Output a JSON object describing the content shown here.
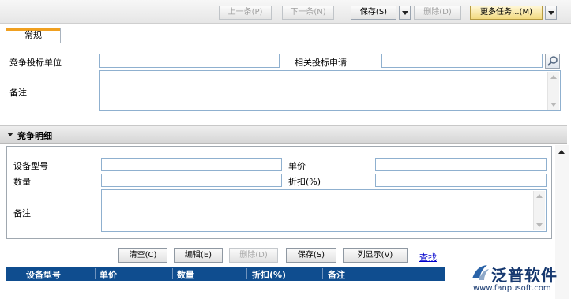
{
  "toolbar": {
    "prev": "上一条(P)",
    "next": "下一条(N)",
    "save": "保存(S)",
    "delete": "删除(D)",
    "more": "更多任务...(M)"
  },
  "tab": {
    "label": "常规"
  },
  "general": {
    "bidder_label": "竞争投标单位",
    "bidder_value": "",
    "related_label": "相关投标申请",
    "related_value": "",
    "remark_label": "备注",
    "remark_value": ""
  },
  "detail": {
    "title": "竞争明细",
    "model_label": "设备型号",
    "price_label": "单价",
    "qty_label": "数量",
    "discount_label": "折扣(%)",
    "remark_label": "备注",
    "model_value": "",
    "price_value": "",
    "qty_value": "",
    "discount_value": "",
    "remark_value": ""
  },
  "detail_actions": {
    "clear": "清空(C)",
    "edit": "编辑(E)",
    "delete": "删除(D)",
    "save": "保存(S)",
    "columns": "列显示(V)",
    "find": "查找"
  },
  "grid": {
    "columns": [
      "设备型号",
      "单价",
      "数量",
      "折扣(%)",
      "备注"
    ]
  },
  "logo": {
    "name": "泛普软件",
    "url": "www.fanpusoft.com",
    "color": "#16386f"
  }
}
